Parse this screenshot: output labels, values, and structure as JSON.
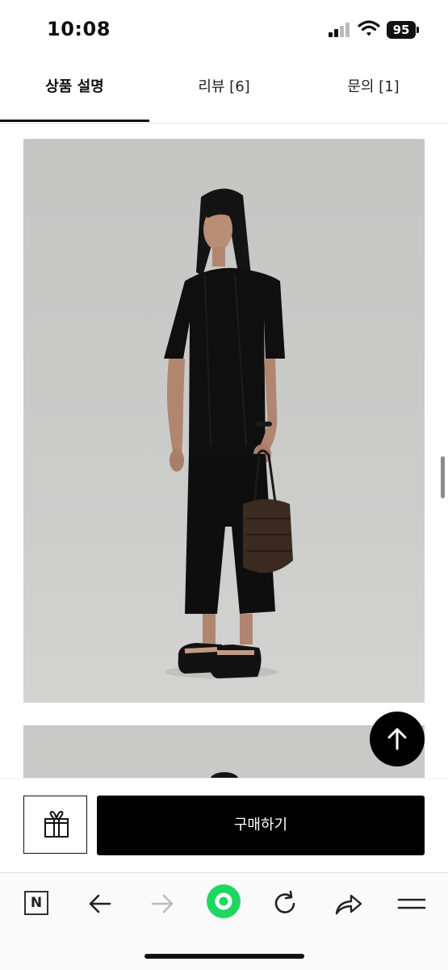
{
  "status_bar": {
    "time": "10:08",
    "battery": "95"
  },
  "tabs": [
    {
      "label": "상품 설명",
      "active": true
    },
    {
      "label": "리뷰 [6]",
      "active": false
    },
    {
      "label": "문의 [1]",
      "active": false
    }
  ],
  "purchase": {
    "buy_label": "구매하기"
  },
  "toolbar": {
    "n_label": "N"
  },
  "icons": {
    "gift": "gift-icon",
    "arrow_up": "arrow-up-icon",
    "back": "back-arrow-icon",
    "forward": "forward-arrow-icon",
    "home": "green-circle-home-icon",
    "reload": "reload-icon",
    "share": "share-icon",
    "menu": "menu-icon"
  },
  "colors": {
    "accent_green": "#1ed760",
    "buy_button": "#000000",
    "photo_background": "#c9c9c8"
  }
}
